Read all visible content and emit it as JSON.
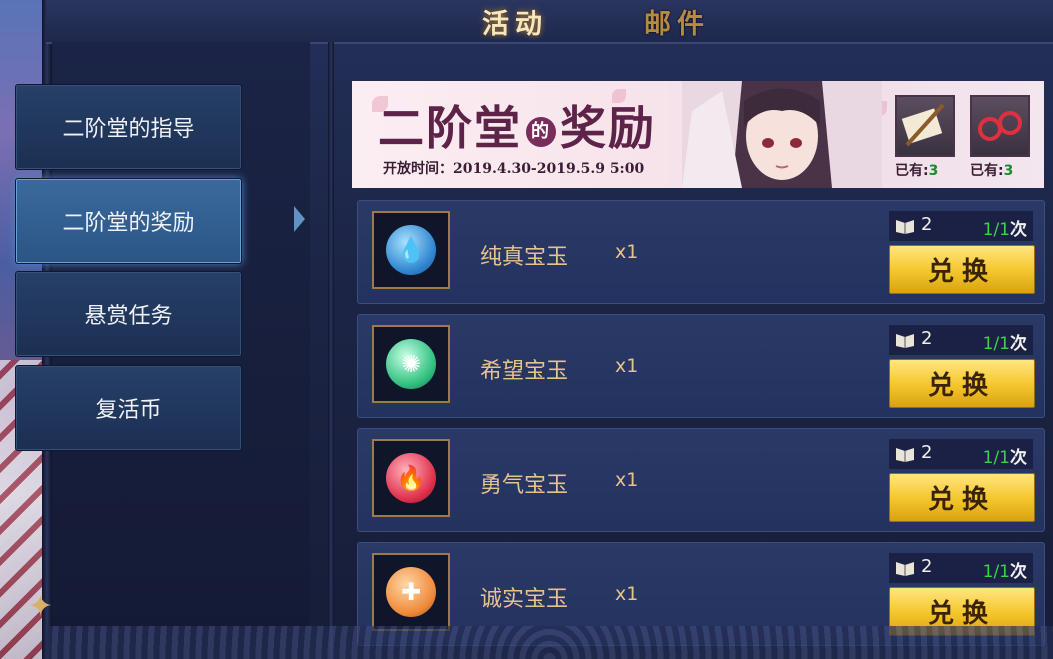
{
  "top_tabs": {
    "active": "活动",
    "mail": "邮件"
  },
  "side_menu": {
    "items": [
      {
        "label": "二阶堂的指导"
      },
      {
        "label": "二阶堂的奖励"
      },
      {
        "label": "悬赏任务"
      },
      {
        "label": "复活币"
      }
    ],
    "selected": "二阶堂的奖励"
  },
  "banner": {
    "title_a": "二阶堂",
    "title_de": "的",
    "title_b": "奖励",
    "open_time": "开放时间：2019.4.30-2019.5.9 5:00",
    "owned": [
      {
        "icon": "book-quill-icon",
        "label": "已有:",
        "count": "3"
      },
      {
        "icon": "glasses-icon",
        "label": "已有:",
        "count": "3"
      }
    ]
  },
  "rewards": [
    {
      "name": "纯真宝玉",
      "qty": "x1",
      "icon": "blue-water-gem-icon",
      "color": "#49a9e8",
      "cost": "2",
      "limit_used": "1/1",
      "limit_unit": "次",
      "button": "兑换"
    },
    {
      "name": "希望宝玉",
      "qty": "x1",
      "icon": "green-hope-gem-icon",
      "color": "#3fcf8c",
      "cost": "2",
      "limit_used": "1/1",
      "limit_unit": "次",
      "button": "兑换"
    },
    {
      "name": "勇气宝玉",
      "qty": "x1",
      "icon": "red-fire-gem-icon",
      "color": "#e8344f",
      "cost": "2",
      "limit_used": "1/1",
      "limit_unit": "次",
      "button": "兑换"
    },
    {
      "name": "诚实宝玉",
      "qty": "x1",
      "icon": "orange-cross-gem-icon",
      "color": "#ef8a3a",
      "cost": "2",
      "limit_used": "1/1",
      "limit_unit": "次",
      "button": "兑换"
    }
  ]
}
